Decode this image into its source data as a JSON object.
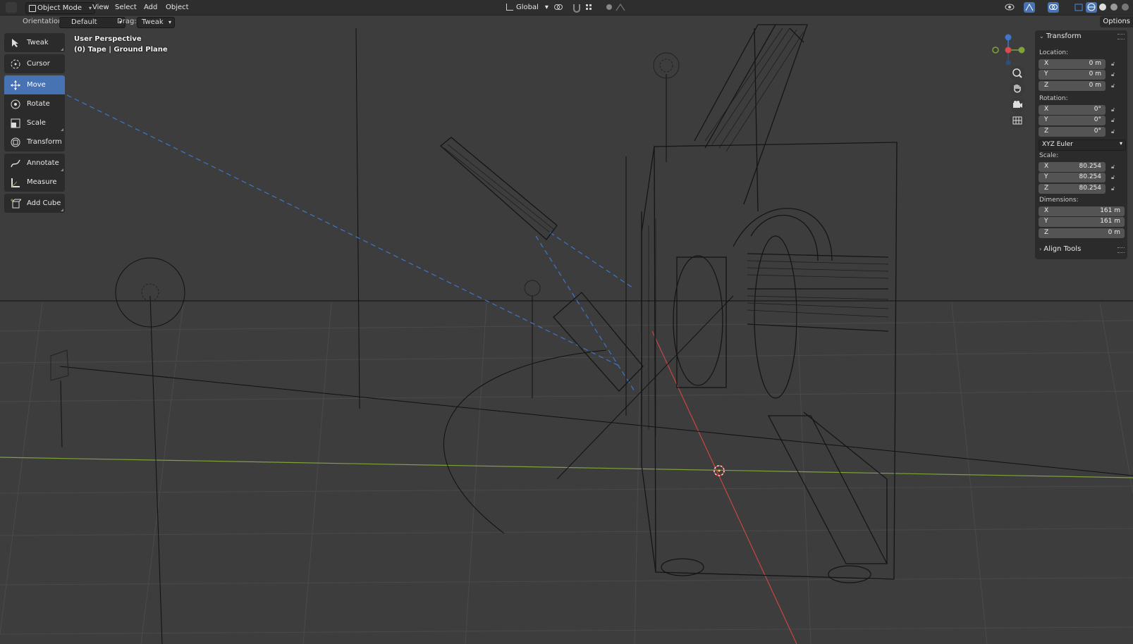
{
  "header": {
    "mode": "Object Mode",
    "menus": [
      "View",
      "Select",
      "Add",
      "Object"
    ],
    "orientation_global": "Global"
  },
  "tool_options": {
    "orientation_label": "Orientation:",
    "orientation_value": "Default",
    "drag_label": "Drag:",
    "drag_value": "Tweak",
    "options": "Options"
  },
  "toolbar": {
    "tools": [
      "Tweak",
      "Cursor",
      "Move",
      "Rotate",
      "Scale",
      "Transform",
      "Annotate",
      "Measure",
      "Add Cube"
    ],
    "active": "Move"
  },
  "viewport": {
    "perspective": "User Perspective",
    "object_info": "(0) Tape | Ground Plane"
  },
  "npanel": {
    "transform_title": "Transform",
    "location_label": "Location:",
    "location": {
      "x": "0 m",
      "y": "0 m",
      "z": "0 m"
    },
    "rotation_label": "Rotation:",
    "rotation": {
      "x": "0°",
      "y": "0°",
      "z": "0°"
    },
    "rotation_mode": "XYZ Euler",
    "scale_label": "Scale:",
    "scale": {
      "x": "80.254",
      "y": "80.254",
      "z": "80.254"
    },
    "dimensions_label": "Dimensions:",
    "dimensions": {
      "x": "161 m",
      "y": "161 m",
      "z": "0 m"
    },
    "align_title": "Align Tools",
    "axis_labels": {
      "x": "X",
      "y": "Y",
      "z": "Z"
    }
  },
  "colors": {
    "accent": "#4772b3",
    "axis_x": "#d94a4a",
    "axis_y": "#7ea33a",
    "axis_z": "#3d77c9"
  }
}
